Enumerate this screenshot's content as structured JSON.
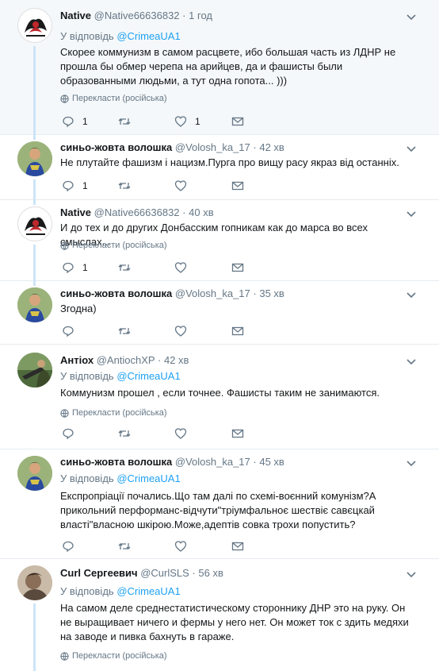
{
  "common": {
    "reply_prefix": "У відповідь",
    "translate_label": "Перекласти (російська)"
  },
  "tweets": [
    {
      "name": "Native",
      "handle": "@Native66636832",
      "dot": "·",
      "time": "1 год",
      "reply_to": "@CrimeaUA1",
      "text": "Скорее коммунизм в самом расцвете, ибо большая часть из ЛДНР не прошла бы обмер черепа на арийцев, да и фашисты были образованными людьми, а тут одна гопота...  )))",
      "reply_count": "1",
      "retweet_count": "",
      "like_count": "1"
    },
    {
      "name": "синьо-жовта волошка",
      "handle": "@Volosh_ka_17",
      "dot": "·",
      "time": "42 хв",
      "text": "Не плутайте фашизм і нацизм.Пурга про вищу расу якраз від останніх.",
      "reply_count": "1",
      "retweet_count": "",
      "like_count": ""
    },
    {
      "name": "Native",
      "handle": "@Native66636832",
      "dot": "·",
      "time": "40 хв",
      "text": "И до тех и до других Донбасским гопникам как до марса во всех смыслах...",
      "reply_count": "1",
      "retweet_count": "",
      "like_count": ""
    },
    {
      "name": "синьо-жовта волошка",
      "handle": "@Volosh_ka_17",
      "dot": "·",
      "time": "35 хв",
      "text": "Згодна)",
      "reply_count": "",
      "retweet_count": "",
      "like_count": ""
    },
    {
      "name": "Антіох",
      "handle": "@AntiochXP",
      "dot": "·",
      "time": "42 хв",
      "reply_to": "@CrimeaUA1",
      "text": "Коммунизм прошел , если точнее. Фашисты таким не занимаются.",
      "reply_count": "",
      "retweet_count": "",
      "like_count": ""
    },
    {
      "name": "синьо-жовта волошка",
      "handle": "@Volosh_ka_17",
      "dot": "·",
      "time": "45 хв",
      "reply_to": "@CrimeaUA1",
      "text": "Експропріації почались.Що там далі по схемі-воєнний комунізм?А прикольний перформанс-відчути\"тріумфальноє шествіє савєцкай власті\"власною шкірою.Може,адептів совка трохи попустить?",
      "reply_count": "",
      "retweet_count": "",
      "like_count": ""
    },
    {
      "name": "Curl Сергеевич",
      "handle": "@CurlSLS",
      "dot": "·",
      "time": "56 хв",
      "reply_to": "@CrimeaUA1",
      "text": "На самом деле среднестатистическому стороннику ДНР это на руку. Он не выращивает ничего и фермы у него нет. Он может ток с    здить медяхи на заводе и пивка бахнуть в гараже."
    }
  ],
  "colors": {
    "accent": "#1da1f2",
    "muted": "#657786",
    "thread_line": "#cce4f7",
    "highlight_bg": "#f5f8fa"
  }
}
